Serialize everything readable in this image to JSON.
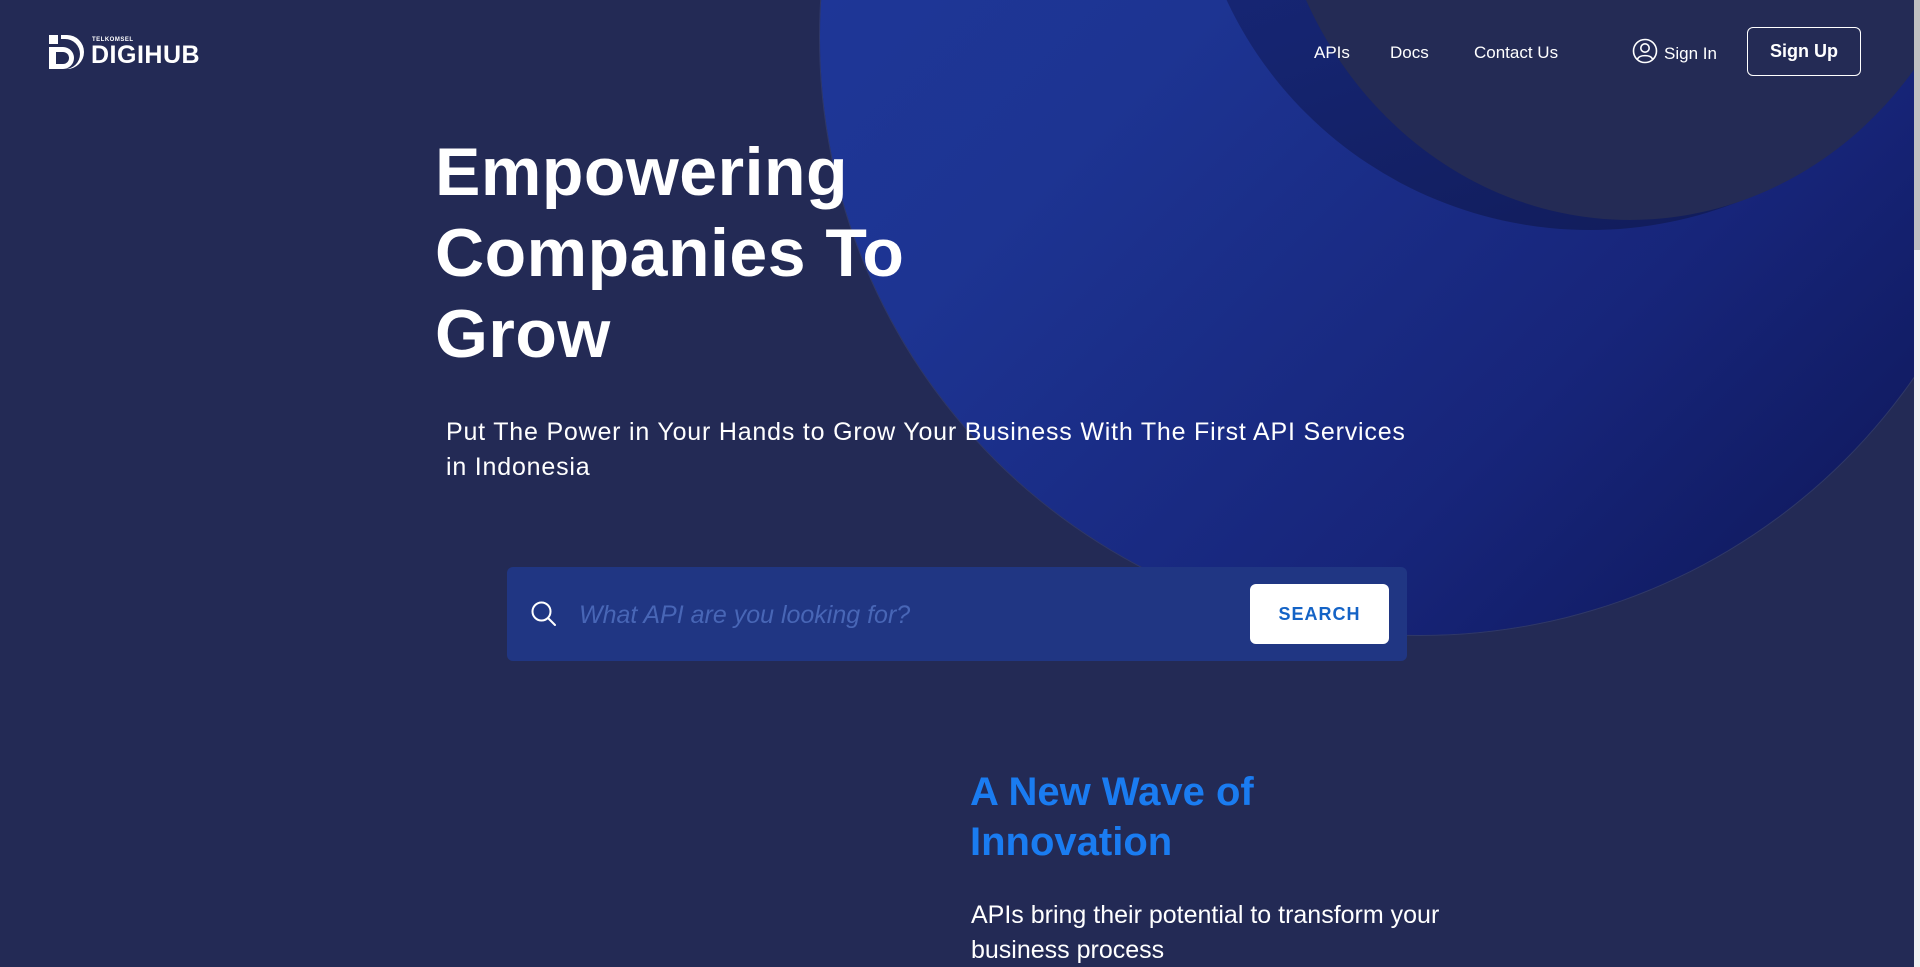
{
  "brand": {
    "small": "TELKOMSEL",
    "name": "DIGIHUB"
  },
  "nav": {
    "apis": "APIs",
    "docs": "Docs",
    "contact": "Contact Us",
    "sign_in": "Sign In",
    "sign_up": "Sign Up"
  },
  "hero": {
    "title": "Empowering Companies To Grow",
    "subtitle": "Put The Power in Your Hands to Grow Your Business With The First API Services in Indonesia"
  },
  "search": {
    "placeholder": "What API are you looking for?",
    "button_label": "SEARCH"
  },
  "section": {
    "title": "A New Wave of Innovation",
    "text": "APIs bring their potential to transform your business process"
  },
  "colors": {
    "background": "#232a55",
    "accent": "#1a7cf1",
    "search_bg": "#203683"
  },
  "icons": {
    "search": "search-icon",
    "user": "user-icon",
    "logo": "digihub-logo-icon"
  }
}
